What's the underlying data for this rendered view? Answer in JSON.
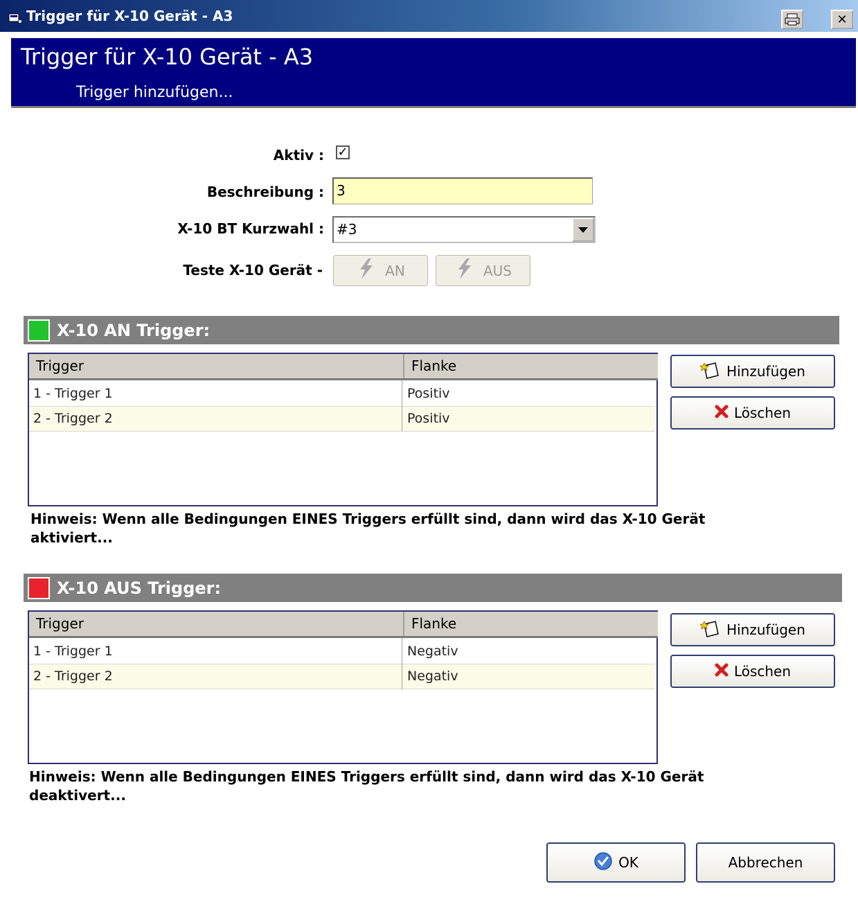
{
  "window": {
    "title": "Trigger für X-10 Gerät - A3"
  },
  "header": {
    "title": "Trigger für X-10 Gerät - A3",
    "subtitle": "Trigger hinzufügen..."
  },
  "form": {
    "aktiv_label": "Aktiv :",
    "aktiv_checked": true,
    "beschreibung_label": "Beschreibung :",
    "beschreibung_value": "3",
    "kurzwahl_label": "X-10 BT Kurzwahl :",
    "kurzwahl_value": "#3",
    "teste_label": "Teste X-10 Gerät -",
    "btn_an": "AN",
    "btn_aus": "AUS"
  },
  "on_section": {
    "title": "X-10 AN Trigger:",
    "color": "#22c22e",
    "columns": [
      "Trigger",
      "Flanke"
    ],
    "rows": [
      {
        "trigger": "1 - Trigger 1",
        "flanke": "Positiv"
      },
      {
        "trigger": "2 - Trigger 2",
        "flanke": "Positiv"
      }
    ],
    "add_label": "Hinzufügen",
    "delete_label": "Löschen",
    "note": "Hinweis: Wenn alle Bedingungen EINES Triggers erfüllt sind, dann wird das X-10 Gerät aktiviert..."
  },
  "off_section": {
    "title": "X-10 AUS Trigger:",
    "color": "#e8232d",
    "columns": [
      "Trigger",
      "Flanke"
    ],
    "rows": [
      {
        "trigger": "1 - Trigger 1",
        "flanke": "Negativ"
      },
      {
        "trigger": "2 - Trigger 2",
        "flanke": "Negativ"
      }
    ],
    "add_label": "Hinzufügen",
    "delete_label": "Löschen",
    "note": "Hinweis: Wenn alle Bedingungen EINES Triggers erfüllt sind, dann wird das X-10 Gerät deaktivert..."
  },
  "footer": {
    "ok_label": "OK",
    "cancel_label": "Abbrechen"
  }
}
